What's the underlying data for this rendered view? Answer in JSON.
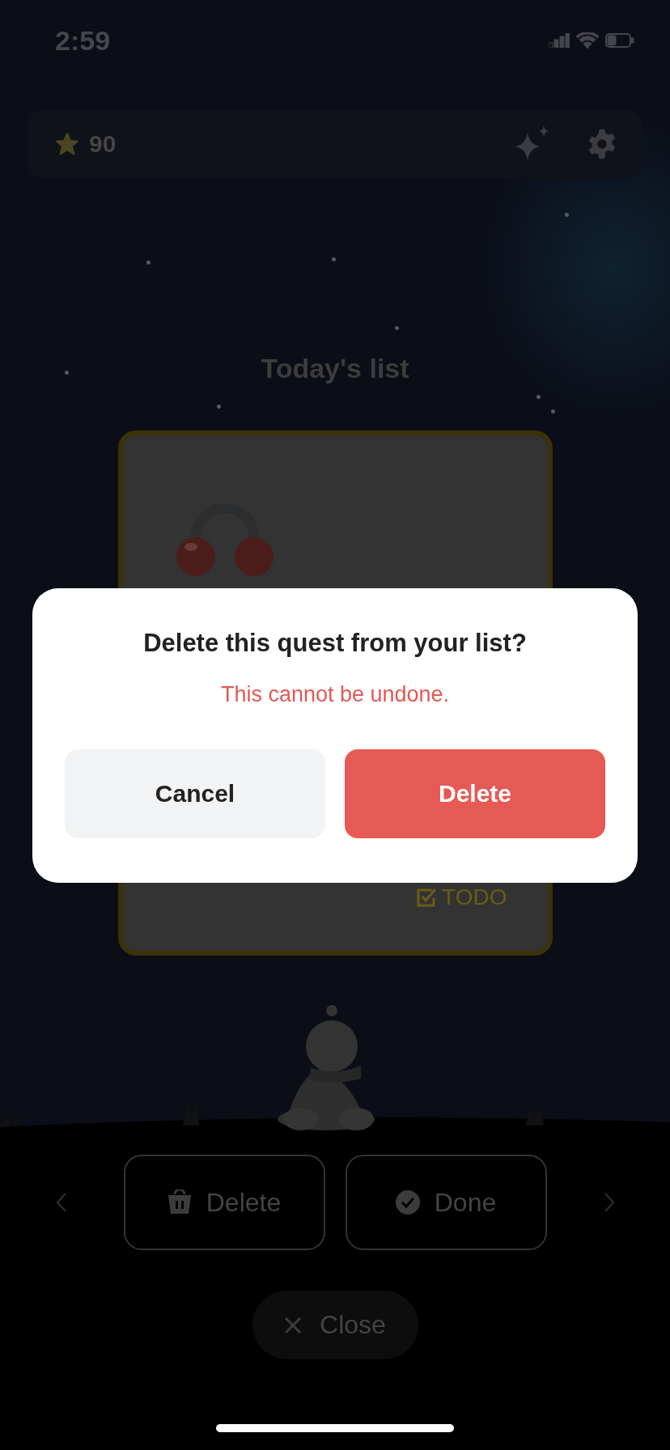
{
  "status_bar": {
    "time": "2:59"
  },
  "top_bar": {
    "points": "90"
  },
  "title": "Today's list",
  "quest_card": {
    "tag": "TODO"
  },
  "actions": [
    {
      "label": "Delete",
      "kind": "delete"
    },
    {
      "label": "Done",
      "kind": "done"
    }
  ],
  "close_button": {
    "label": "Close"
  },
  "dialog": {
    "title": "Delete this quest from your list?",
    "warning": "This cannot be undone.",
    "buttons": [
      {
        "label": "Cancel",
        "kind": "secondary"
      },
      {
        "label": "Delete",
        "kind": "destructive"
      }
    ]
  }
}
